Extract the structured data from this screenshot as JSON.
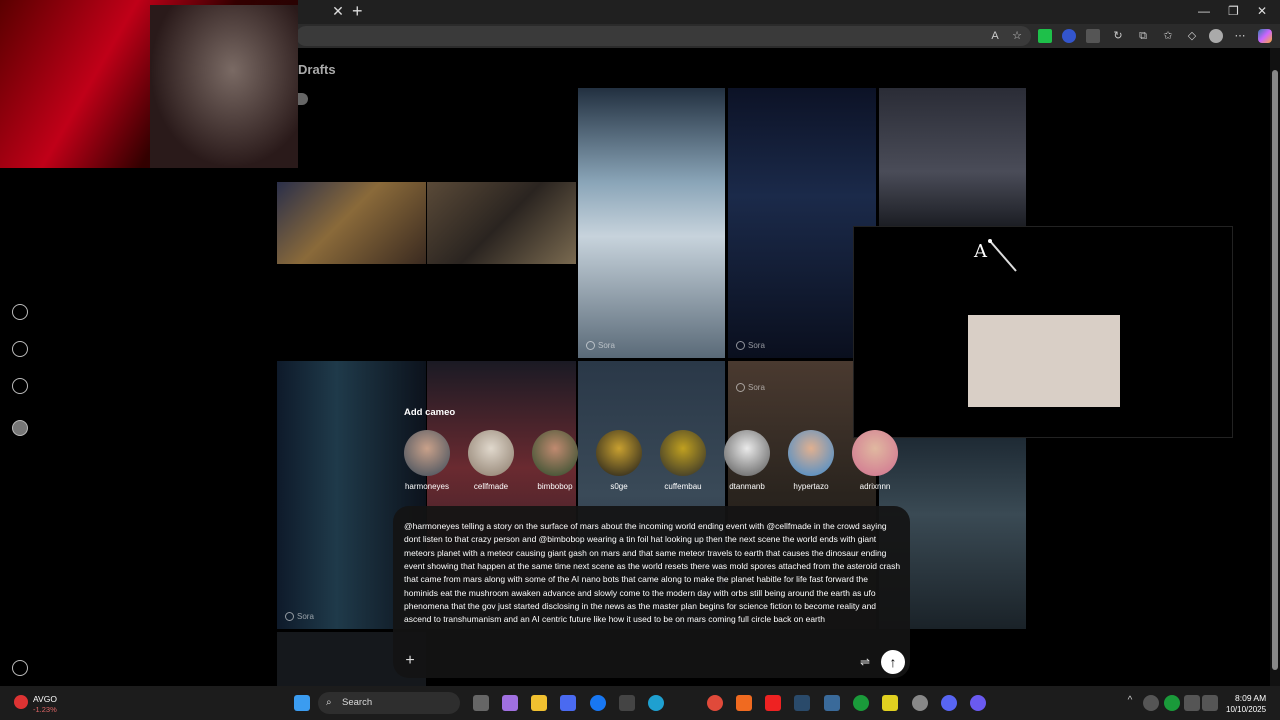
{
  "browser": {
    "tab_close": "✕",
    "tab_new": "+",
    "window_minimize": "—",
    "window_restore": "❐",
    "window_close": "✕"
  },
  "page": {
    "title": "Drafts",
    "watermark": "Sora"
  },
  "cameo": {
    "heading": "Add cameo",
    "users": [
      "harmoneyes",
      "cellfmade",
      "bimbobop",
      "s0ge",
      "cuffembau",
      "dtanmanb",
      "hypertazo",
      "adrixnnn"
    ]
  },
  "popup": {
    "icon_letter": "A"
  },
  "composer": {
    "prompt": "@harmoneyes telling a story on the surface of mars about the incoming world ending event with @cellfmade in the crowd saying dont listen to that crazy person and @bimbobop wearing a tin foil hat looking up then the next scene the world ends with giant meteors planet with a meteor causing giant gash on mars and that same meteor travels to earth that causes the dinosaur ending event showing that happen at the same time next scene as the world resets there was mold spores attached from the asteroid crash that came from mars along with some of the AI nano bots that came along to make the planet habitle for life fast forward the hominids eat the mushroom awaken advance and slowly come to the modern day with orbs still being around the earth as ufo phenomena that the gov just started disclosing in the news as the master plan begins for science fiction to become reality and ascend to transhumanism and an AI centric future like how it used to be on mars coming full circle back on earth",
    "add_icon": "+",
    "settings_icon": "⇌",
    "send_icon": "↑"
  },
  "taskbar": {
    "stock_symbol": "AVGO",
    "stock_change": "-1.23%",
    "search_label": "Search",
    "time": "8:09 AM",
    "date": "10/10/2025"
  }
}
